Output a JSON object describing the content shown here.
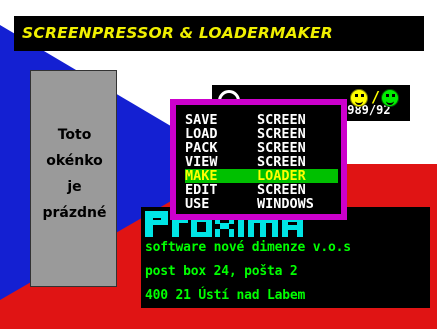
{
  "title": "SCREENPRESSOR & LOADERMAKER",
  "info_panel": {
    "lines": [
      "Toto",
      "okénko",
      "je",
      "prázdné"
    ]
  },
  "year_badge": {
    "text": "1989/92",
    "separator": "/"
  },
  "menu": {
    "items": [
      {
        "w1": "SAVE",
        "w2": "SCREEN"
      },
      {
        "w1": "LOAD",
        "w2": "SCREEN"
      },
      {
        "w1": "PACK",
        "w2": "SCREEN"
      },
      {
        "w1": "VIEW",
        "w2": "SCREEN"
      },
      {
        "w1": "MAKE",
        "w2": "LOADER",
        "selected": true
      },
      {
        "w1": "EDIT",
        "w2": "SCREEN"
      },
      {
        "w1": "USE",
        "w2": "WINDOWS"
      }
    ]
  },
  "company": {
    "logo": "PROXIMA",
    "lines": [
      "software nové dimenze v.o.s",
      "post box 24, pošta 2",
      "400 21 Ústí nad Labem"
    ]
  },
  "colors": {
    "flag_red": "#e01414",
    "flag_blue": "#1420d2",
    "flag_white": "#ffffff",
    "title_yellow": "#f0f000",
    "menu_border": "#cc00cc",
    "menu_highlight": "#00c000",
    "company_text": "#00ff00",
    "logo_cyan": "#00e5e5"
  }
}
